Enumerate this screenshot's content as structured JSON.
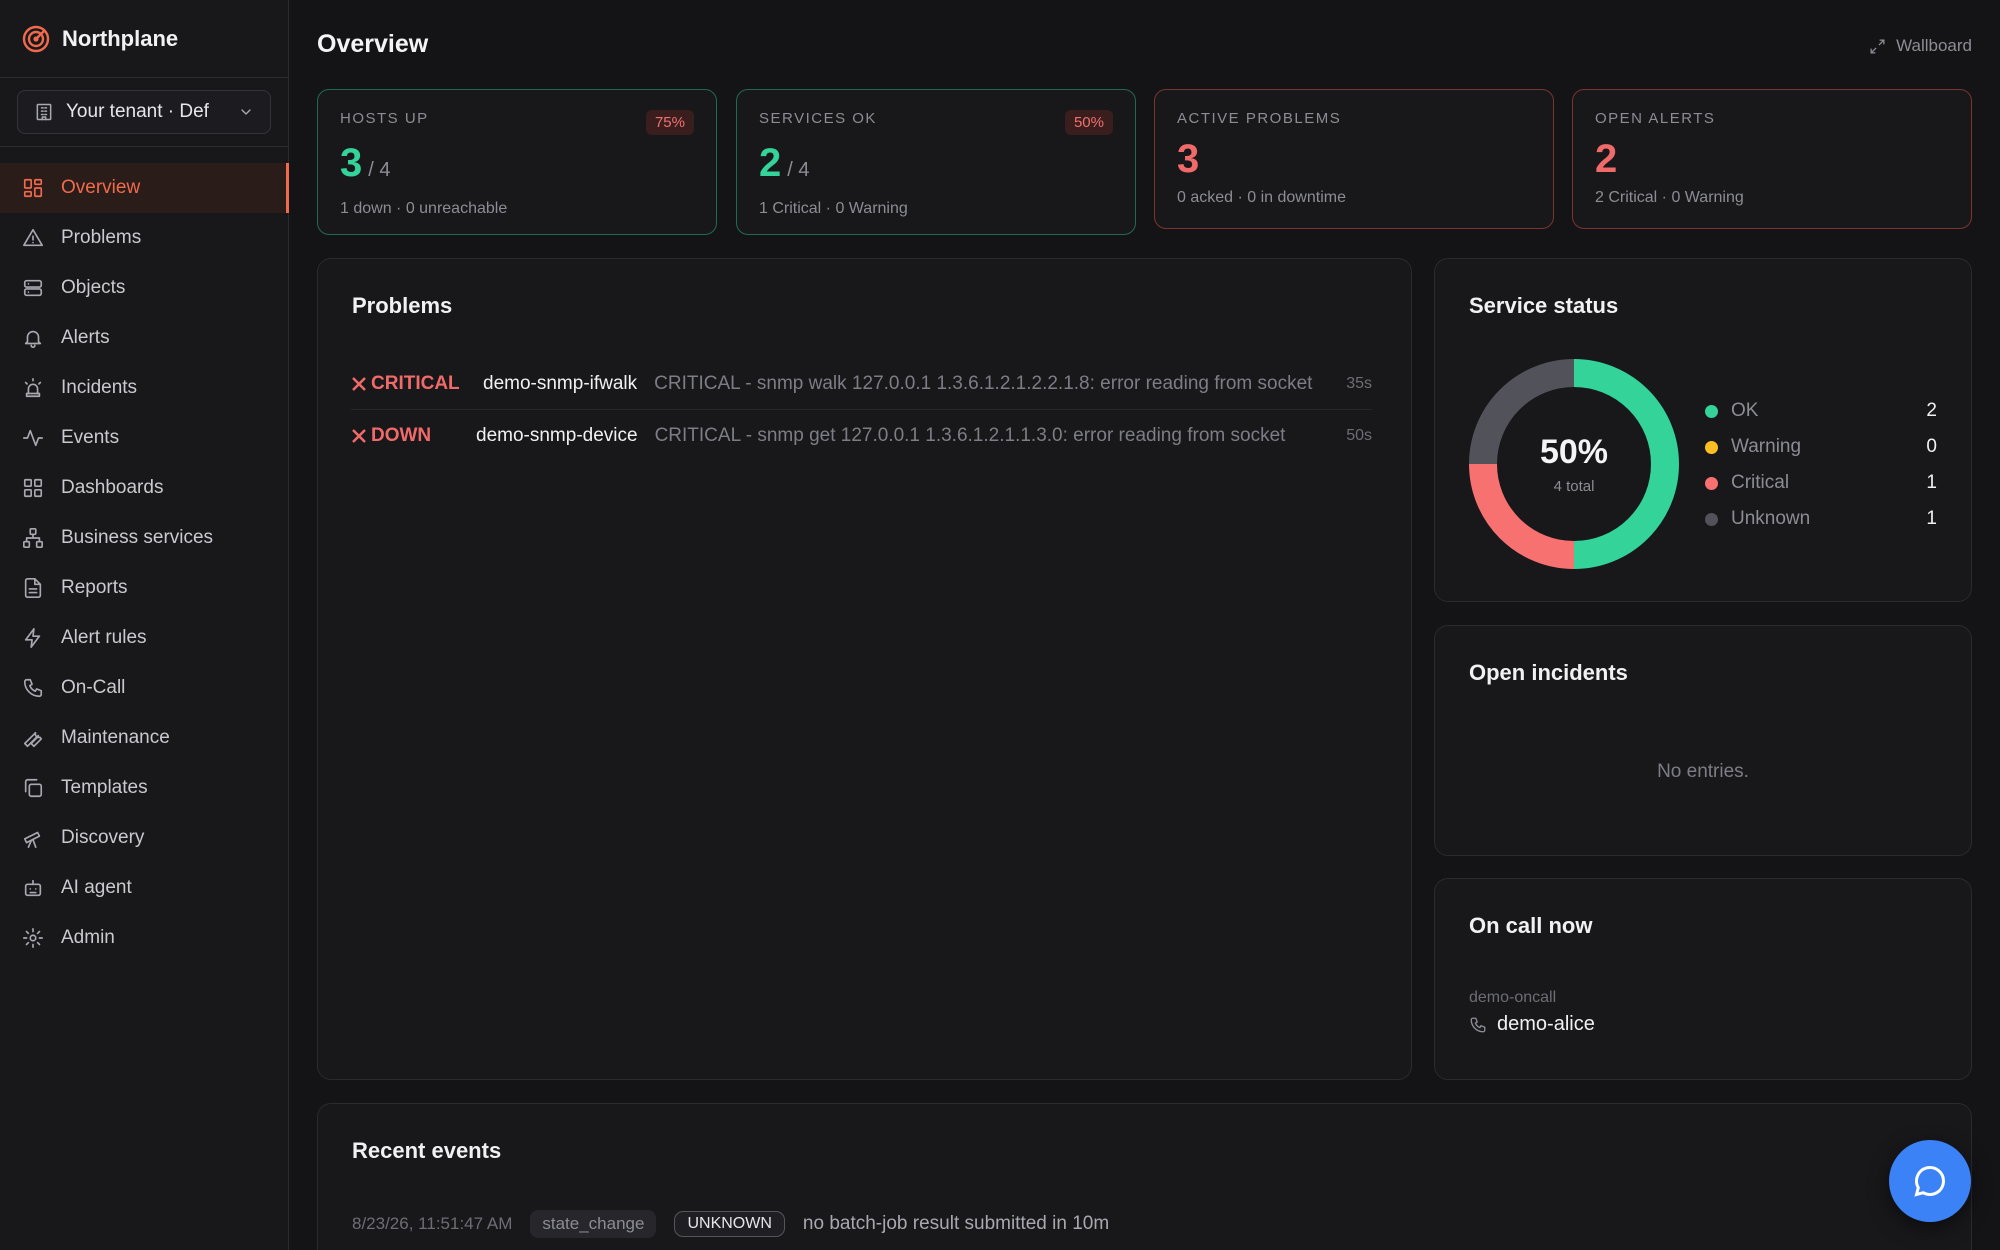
{
  "brand": {
    "name": "Northplane"
  },
  "tenant": {
    "label": "Your tenant · Def"
  },
  "nav": [
    {
      "label": "Overview",
      "icon": "grid-icon",
      "active": true
    },
    {
      "label": "Problems",
      "icon": "warning-triangle-icon"
    },
    {
      "label": "Objects",
      "icon": "server-icon"
    },
    {
      "label": "Alerts",
      "icon": "bell-icon"
    },
    {
      "label": "Incidents",
      "icon": "siren-icon"
    },
    {
      "label": "Events",
      "icon": "activity-icon"
    },
    {
      "label": "Dashboards",
      "icon": "dashboard-icon"
    },
    {
      "label": "Business services",
      "icon": "hierarchy-icon"
    },
    {
      "label": "Reports",
      "icon": "file-icon"
    },
    {
      "label": "Alert rules",
      "icon": "bolt-icon"
    },
    {
      "label": "On-Call",
      "icon": "phone-icon"
    },
    {
      "label": "Maintenance",
      "icon": "wrench-icon"
    },
    {
      "label": "Templates",
      "icon": "copy-icon"
    },
    {
      "label": "Discovery",
      "icon": "telescope-icon"
    },
    {
      "label": "AI agent",
      "icon": "robot-icon"
    },
    {
      "label": "Admin",
      "icon": "gear-icon"
    }
  ],
  "header": {
    "title": "Overview",
    "wallboard_label": "Wallboard"
  },
  "kpis": {
    "hosts": {
      "label": "Hosts up",
      "badge": "75%",
      "value": "3",
      "total": "/ 4",
      "sub": "1 down · 0 unreachable"
    },
    "services": {
      "label": "Services ok",
      "badge": "50%",
      "value": "2",
      "total": "/ 4",
      "sub": "1 Critical · 0 Warning"
    },
    "problems": {
      "label": "Active problems",
      "value": "3",
      "sub": "0 acked · 0 in downtime"
    },
    "alerts": {
      "label": "Open alerts",
      "value": "2",
      "sub": "2 Critical · 0 Warning"
    }
  },
  "problems": {
    "title": "Problems",
    "rows": [
      {
        "state": "CRITICAL",
        "host": "demo-snmp-ifwalk",
        "message": "CRITICAL - snmp walk 127.0.0.1 1.3.6.1.2.1.2.2.1.8: error reading from socket",
        "age": "35s"
      },
      {
        "state": "DOWN",
        "host": "demo-snmp-device",
        "message": "CRITICAL - snmp get 127.0.0.1 1.3.6.1.2.1.1.3.0: error reading from socket",
        "age": "50s"
      }
    ]
  },
  "service_status": {
    "title": "Service status",
    "percent": "50%",
    "total": "4 total",
    "segments": [
      {
        "label": "OK",
        "value": 2,
        "color": "#34d399"
      },
      {
        "label": "Warning",
        "value": 0,
        "color": "#fbbf24"
      },
      {
        "label": "Critical",
        "value": 1,
        "color": "#f87171"
      },
      {
        "label": "Unknown",
        "value": 1,
        "color": "#52525b"
      }
    ]
  },
  "incidents": {
    "title": "Open incidents",
    "empty": "No entries."
  },
  "oncall": {
    "title": "On call now",
    "schedule": "demo-oncall",
    "user": "demo-alice"
  },
  "events": {
    "title": "Recent events",
    "rows": [
      {
        "time": "8/23/26, 11:51:47 AM",
        "type": "state_change",
        "severity": "UNKNOWN",
        "message": "no batch-job result submitted in 10m"
      }
    ]
  }
}
